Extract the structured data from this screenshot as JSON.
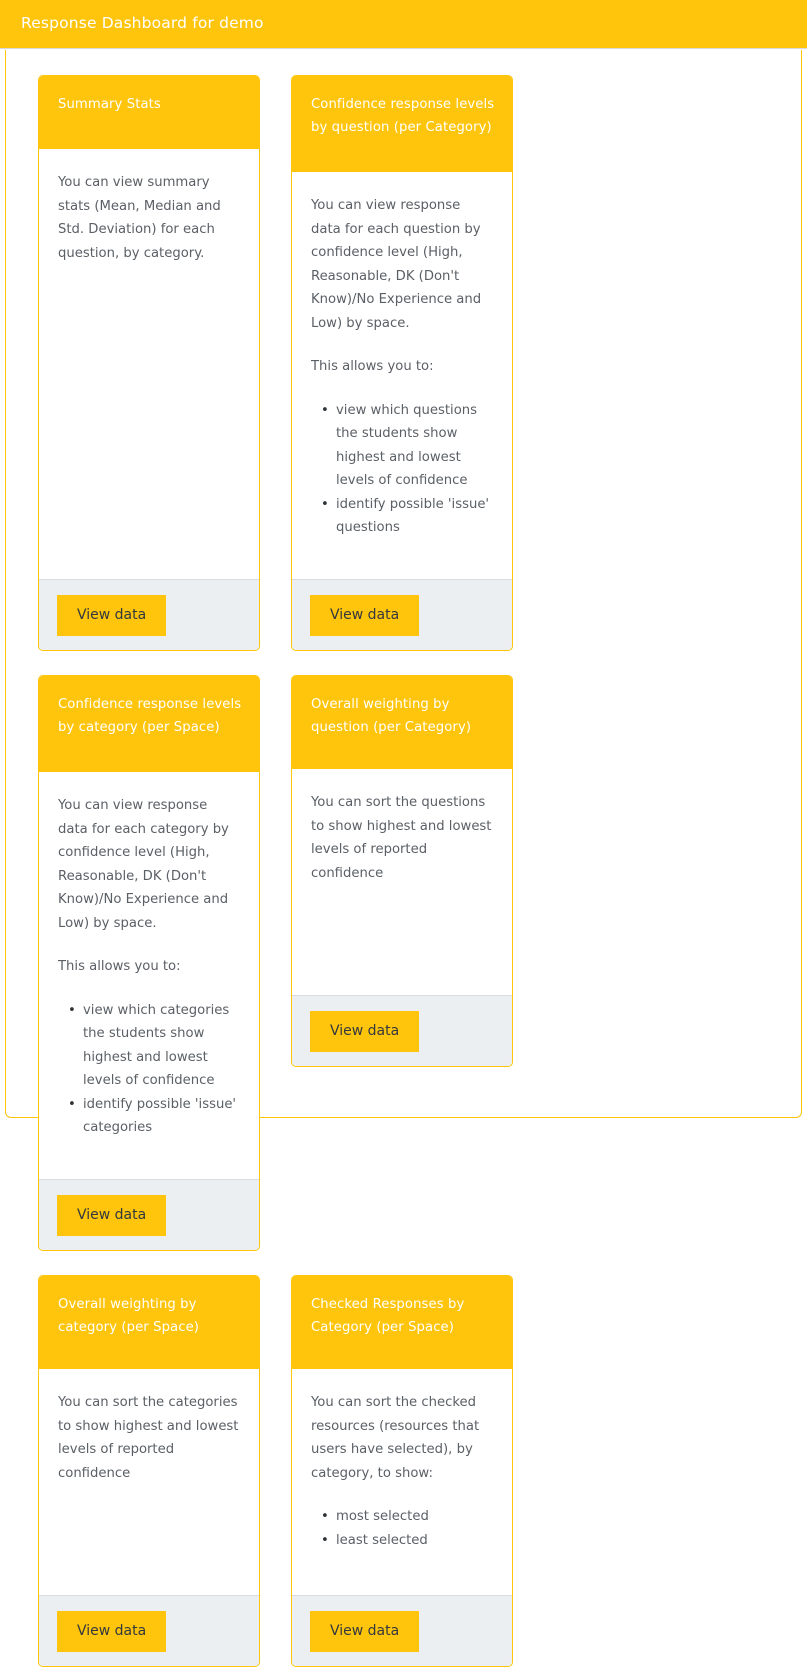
{
  "header": {
    "title": "Response Dashboard for demo",
    "background_color": "#ffc40c",
    "text_color": "#ffffff"
  },
  "theme": {
    "accent_color": "#ffc40c",
    "body_text_color": "#5b6066",
    "footer_background": "#eceff1",
    "button_text_color": "#33383d"
  },
  "cards": [
    {
      "title": "Summary Stats",
      "paragraphs": [
        "You can view summary stats (Mean, Median and Std. Deviation) for each question, by category."
      ],
      "list_intro": "",
      "bullets": [],
      "button_label": "View data"
    },
    {
      "title": "Confidence response levels by question (per Category)",
      "paragraphs": [
        "You can view response data for each question by confidence level (High, Reasonable, DK (Don't Know)/No Experience and Low) by space."
      ],
      "list_intro": "This allows you to:",
      "bullets": [
        "view which questions the students show highest and lowest levels of confidence",
        "identify possible 'issue' questions"
      ],
      "button_label": "View data"
    },
    {
      "title": "Confidence response levels by category (per Space)",
      "paragraphs": [
        "You can view response data for each category by confidence level (High, Reasonable, DK (Don't Know)/No Experience and Low) by space."
      ],
      "list_intro": "This allows you to:",
      "bullets": [
        "view which categories the students show highest and lowest levels of confidence",
        "identify possible 'issue' categories"
      ],
      "button_label": "View data"
    },
    {
      "title": "Overall weighting by question (per Category)",
      "paragraphs": [
        "You can sort the questions to show highest and lowest levels of reported confidence"
      ],
      "list_intro": "",
      "bullets": [],
      "button_label": "View data"
    },
    {
      "title": "Overall weighting by category (per Space)",
      "paragraphs": [
        "You can sort the categories to show highest and lowest levels of reported confidence"
      ],
      "list_intro": "",
      "bullets": [],
      "button_label": "View data"
    },
    {
      "title": "Checked Responses by Category (per Space)",
      "paragraphs": [
        "You can sort the checked resources (resources that users have selected), by category, to show:"
      ],
      "list_intro": "",
      "bullets": [
        "most selected",
        "least selected"
      ],
      "button_label": "View data"
    }
  ]
}
